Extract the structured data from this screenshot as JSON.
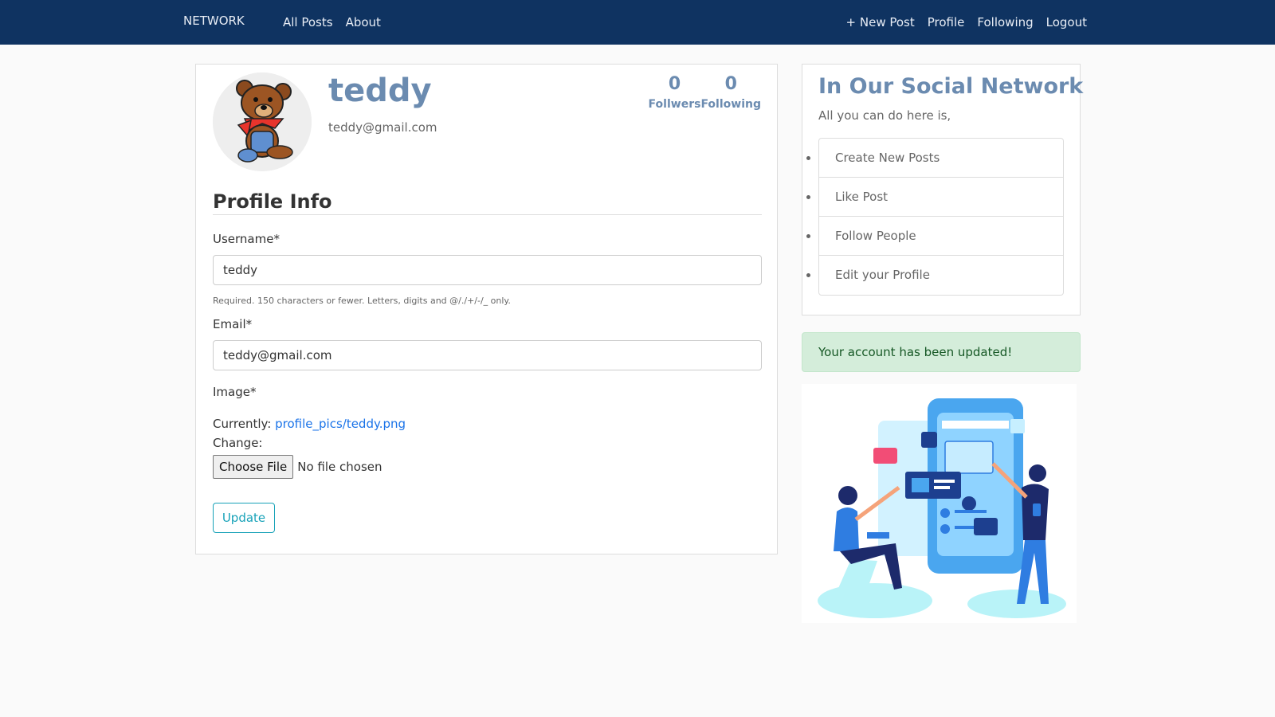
{
  "nav": {
    "brand": "NETWORK",
    "left_links": [
      "All Posts",
      "About"
    ],
    "right_links": [
      "+ New Post",
      "Profile",
      "Following",
      "Logout"
    ]
  },
  "profile": {
    "username": "teddy",
    "email": "teddy@gmail.com",
    "followers_count": "0",
    "followers_label": "Follwers",
    "following_count": "0",
    "following_label": "Following"
  },
  "form": {
    "title": "Profile Info",
    "username_label": "Username*",
    "username_value": "teddy",
    "username_help": "Required. 150 characters or fewer. Letters, digits and @/./+/-/_ only.",
    "email_label": "Email*",
    "email_value": "teddy@gmail.com",
    "image_label": "Image*",
    "currently_label": "Currently:",
    "currently_link": "profile_pics/teddy.png",
    "change_label": "Change:",
    "file_button": "Choose File",
    "file_status": "No file chosen",
    "submit_label": "Update"
  },
  "sidebar": {
    "title": "In Our Social Network",
    "subtitle": "All you can do here is,",
    "items": [
      "Create New Posts",
      "Like Post",
      "Follow People",
      "Edit your Profile"
    ]
  },
  "alert": {
    "message": "Your account has been updated!"
  },
  "colors": {
    "navbar": "#0f3361",
    "accent_heading": "#6b8bb0",
    "button_outline": "#17a2b8",
    "alert_bg": "#d4edda",
    "alert_text": "#155724"
  }
}
